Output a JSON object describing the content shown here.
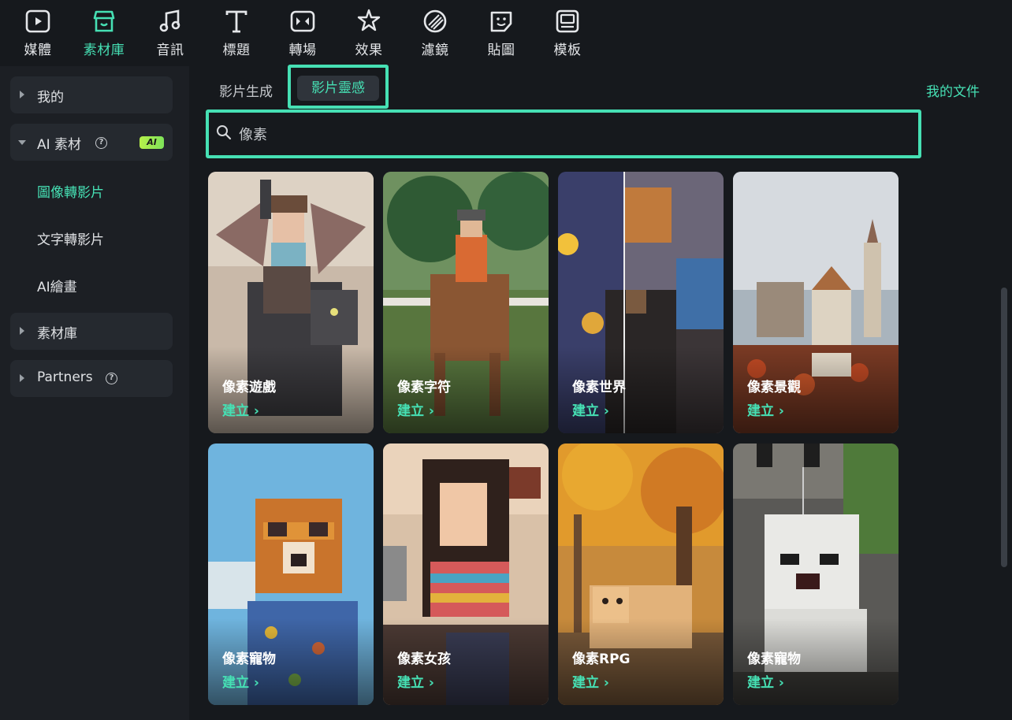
{
  "toolbar": {
    "items": [
      {
        "label": "媒體",
        "icon": "media-icon"
      },
      {
        "label": "素材庫",
        "icon": "store-icon"
      },
      {
        "label": "音訊",
        "icon": "music-note-icon"
      },
      {
        "label": "標題",
        "icon": "text-t-icon"
      },
      {
        "label": "轉場",
        "icon": "transition-icon"
      },
      {
        "label": "效果",
        "icon": "effects-star-icon"
      },
      {
        "label": "濾鏡",
        "icon": "filter-icon"
      },
      {
        "label": "貼圖",
        "icon": "sticker-icon"
      },
      {
        "label": "模板",
        "icon": "template-icon"
      }
    ],
    "active": "素材庫"
  },
  "sidebar": {
    "mine": "我的",
    "ai_assets": "AI 素材",
    "ai_badge": "AI",
    "sub_items": [
      "圖像轉影片",
      "文字轉影片",
      "AI繪畫"
    ],
    "active_sub": "圖像轉影片",
    "library": "素材庫",
    "partners": "Partners"
  },
  "tabs": {
    "generate": "影片生成",
    "inspiration": "影片靈感",
    "active": "影片靈感",
    "my_docs": "我的文件"
  },
  "search": {
    "value": "像素"
  },
  "cards": [
    {
      "title": "像素遊戲",
      "action": "建立 ›"
    },
    {
      "title": "像素字符",
      "action": "建立 ›"
    },
    {
      "title": "像素世界",
      "action": "建立 ›"
    },
    {
      "title": "像素景觀",
      "action": "建立 ›"
    },
    {
      "title": "像素寵物",
      "action": "建立 ›"
    },
    {
      "title": "像素女孩",
      "action": "建立 ›"
    },
    {
      "title": "像素RPG",
      "action": "建立 ›"
    },
    {
      "title": "像素寵物",
      "action": "建立 ›"
    }
  ],
  "colors": {
    "accent": "#46e0b4",
    "background": "#16191d",
    "sidebar": "#1c1f24"
  }
}
